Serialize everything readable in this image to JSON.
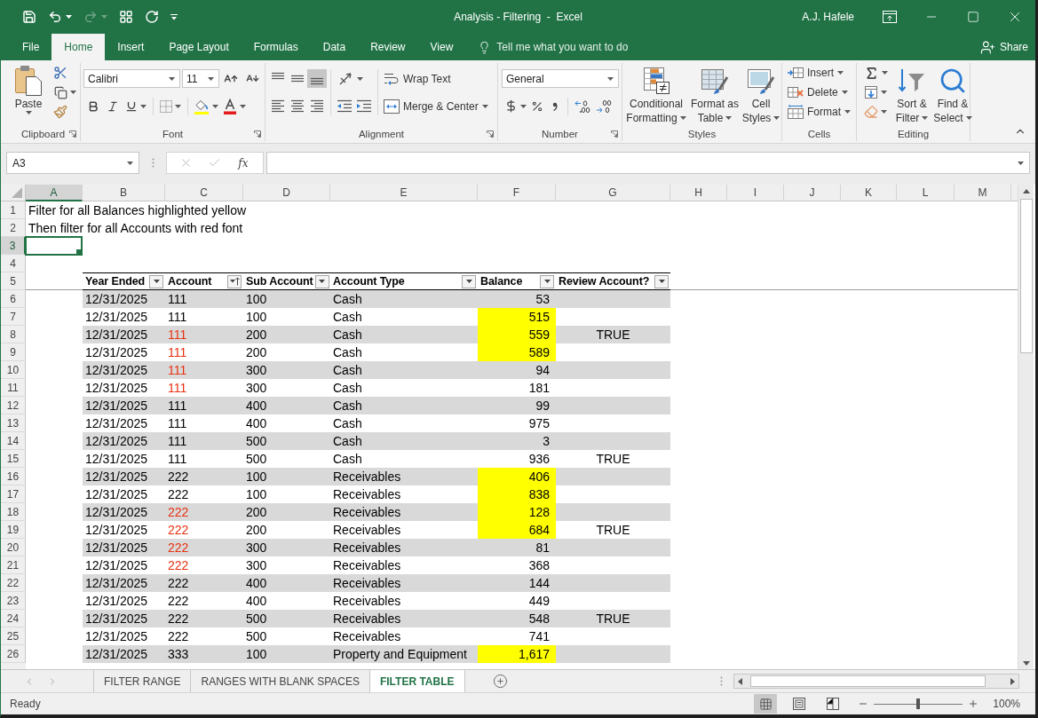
{
  "window": {
    "title": "Analysis - Filtering  -  Excel",
    "user": "A.J. Hafele"
  },
  "quick_access": [
    {
      "kind": "save",
      "disabled": false
    },
    {
      "kind": "undo",
      "disabled": false
    },
    {
      "kind": "redo",
      "disabled": true
    },
    {
      "kind": "form",
      "disabled": false
    },
    {
      "kind": "refresh",
      "disabled": false
    },
    {
      "kind": "customize",
      "disabled": false
    }
  ],
  "ribbon_tabs": [
    {
      "label": "File",
      "selected": false
    },
    {
      "label": "Home",
      "selected": true
    },
    {
      "label": "Insert",
      "selected": false
    },
    {
      "label": "Page Layout",
      "selected": false
    },
    {
      "label": "Formulas",
      "selected": false
    },
    {
      "label": "Data",
      "selected": false
    },
    {
      "label": "Review",
      "selected": false
    },
    {
      "label": "View",
      "selected": false
    }
  ],
  "tell_me": {
    "label": "Tell me what you want to do"
  },
  "share": {
    "label": "Share"
  },
  "clipboard": {
    "label": "Clipboard",
    "paste": "Paste"
  },
  "font": {
    "label": "Font",
    "name": "Calibri",
    "size": "11"
  },
  "alignment": {
    "label": "Alignment",
    "vertical": [
      {
        "kind": "top",
        "selected": false
      },
      {
        "kind": "middle",
        "selected": false
      },
      {
        "kind": "bottom",
        "selected": true
      }
    ],
    "wrap_text": "Wrap Text",
    "merge_center": "Merge & Center"
  },
  "number": {
    "label": "Number",
    "format": "General"
  },
  "styles": {
    "label": "Styles",
    "buttons": [
      {
        "kind": "conditional",
        "lines": [
          "Conditional",
          "Formatting"
        ]
      },
      {
        "kind": "table",
        "lines": [
          "Format as",
          "Table"
        ]
      },
      {
        "kind": "cell",
        "lines": [
          "Cell",
          "Styles"
        ]
      }
    ]
  },
  "cells": {
    "label": "Cells",
    "buttons": [
      {
        "kind": "insert",
        "label": "Insert"
      },
      {
        "kind": "delete",
        "label": "Delete"
      },
      {
        "kind": "format",
        "label": "Format"
      }
    ]
  },
  "editing": {
    "label": "Editing",
    "buttons": [
      {
        "kind": "sort",
        "lines": [
          "Sort &",
          "Filter"
        ]
      },
      {
        "kind": "find",
        "lines": [
          "Find &",
          "Select"
        ]
      }
    ]
  },
  "formula_bar": {
    "name_box": "A3",
    "insert_function": "fx"
  },
  "column_headers": [
    {
      "label": "A",
      "selected": true
    },
    {
      "label": "B",
      "selected": false
    },
    {
      "label": "C",
      "selected": false
    },
    {
      "label": "D",
      "selected": false
    },
    {
      "label": "E",
      "selected": false
    },
    {
      "label": "F",
      "selected": false
    },
    {
      "label": "G",
      "selected": false
    },
    {
      "label": "H",
      "selected": false
    },
    {
      "label": "I",
      "selected": false
    },
    {
      "label": "J",
      "selected": false
    },
    {
      "label": "K",
      "selected": false
    },
    {
      "label": "L",
      "selected": false
    },
    {
      "label": "M",
      "selected": false
    }
  ],
  "row_headers": [
    {
      "label": "1",
      "selected": false
    },
    {
      "label": "2",
      "selected": false
    },
    {
      "label": "3",
      "selected": true
    },
    {
      "label": "4",
      "selected": false
    },
    {
      "label": "5",
      "selected": false
    },
    {
      "label": "6",
      "selected": false
    },
    {
      "label": "7",
      "selected": false
    },
    {
      "label": "8",
      "selected": false
    },
    {
      "label": "9",
      "selected": false
    },
    {
      "label": "10",
      "selected": false
    },
    {
      "label": "11",
      "selected": false
    },
    {
      "label": "12",
      "selected": false
    },
    {
      "label": "13",
      "selected": false
    },
    {
      "label": "14",
      "selected": false
    },
    {
      "label": "15",
      "selected": false
    },
    {
      "label": "16",
      "selected": false
    },
    {
      "label": "17",
      "selected": false
    },
    {
      "label": "18",
      "selected": false
    },
    {
      "label": "19",
      "selected": false
    },
    {
      "label": "20",
      "selected": false
    },
    {
      "label": "21",
      "selected": false
    },
    {
      "label": "22",
      "selected": false
    },
    {
      "label": "23",
      "selected": false
    },
    {
      "label": "24",
      "selected": false
    },
    {
      "label": "25",
      "selected": false
    },
    {
      "label": "26",
      "selected": false
    }
  ],
  "sheet": {
    "notes": [
      "Filter for all Balances highlighted yellow",
      "Then filter for all Accounts with red font"
    ]
  },
  "table": {
    "columns": [
      {
        "label": "Year Ended",
        "sorted": false
      },
      {
        "label": "Account",
        "sorted": true
      },
      {
        "label": "Sub Account",
        "sorted": false
      },
      {
        "label": "Account Type",
        "sorted": false
      },
      {
        "label": "Balance",
        "sorted": false
      },
      {
        "label": "Review Account?",
        "sorted": false
      }
    ],
    "rows": [
      {
        "year_ended": "12/31/2025",
        "account": "111",
        "red_font": false,
        "sub_account": "100",
        "account_type": "Cash",
        "balance": "53",
        "highlighted": false
      },
      {
        "year_ended": "12/31/2025",
        "account": "111",
        "red_font": false,
        "sub_account": "100",
        "account_type": "Cash",
        "balance": "515",
        "highlighted": true
      },
      {
        "year_ended": "12/31/2025",
        "account": "111",
        "red_font": true,
        "sub_account": "200",
        "account_type": "Cash",
        "balance": "559",
        "highlighted": true,
        "review_account": "TRUE"
      },
      {
        "year_ended": "12/31/2025",
        "account": "111",
        "red_font": true,
        "sub_account": "200",
        "account_type": "Cash",
        "balance": "589",
        "highlighted": true
      },
      {
        "year_ended": "12/31/2025",
        "account": "111",
        "red_font": true,
        "sub_account": "300",
        "account_type": "Cash",
        "balance": "94",
        "highlighted": false
      },
      {
        "year_ended": "12/31/2025",
        "account": "111",
        "red_font": true,
        "sub_account": "300",
        "account_type": "Cash",
        "balance": "181",
        "highlighted": false
      },
      {
        "year_ended": "12/31/2025",
        "account": "111",
        "red_font": false,
        "sub_account": "400",
        "account_type": "Cash",
        "balance": "99",
        "highlighted": false
      },
      {
        "year_ended": "12/31/2025",
        "account": "111",
        "red_font": false,
        "sub_account": "400",
        "account_type": "Cash",
        "balance": "975",
        "highlighted": false
      },
      {
        "year_ended": "12/31/2025",
        "account": "111",
        "red_font": false,
        "sub_account": "500",
        "account_type": "Cash",
        "balance": "3",
        "highlighted": false
      },
      {
        "year_ended": "12/31/2025",
        "account": "111",
        "red_font": false,
        "sub_account": "500",
        "account_type": "Cash",
        "balance": "936",
        "highlighted": false,
        "review_account": "TRUE"
      },
      {
        "year_ended": "12/31/2025",
        "account": "222",
        "red_font": false,
        "sub_account": "100",
        "account_type": "Receivables",
        "balance": "406",
        "highlighted": true
      },
      {
        "year_ended": "12/31/2025",
        "account": "222",
        "red_font": false,
        "sub_account": "100",
        "account_type": "Receivables",
        "balance": "838",
        "highlighted": true
      },
      {
        "year_ended": "12/31/2025",
        "account": "222",
        "red_font": true,
        "sub_account": "200",
        "account_type": "Receivables",
        "balance": "128",
        "highlighted": true
      },
      {
        "year_ended": "12/31/2025",
        "account": "222",
        "red_font": true,
        "sub_account": "200",
        "account_type": "Receivables",
        "balance": "684",
        "highlighted": true,
        "review_account": "TRUE"
      },
      {
        "year_ended": "12/31/2025",
        "account": "222",
        "red_font": true,
        "sub_account": "300",
        "account_type": "Receivables",
        "balance": "81",
        "highlighted": false
      },
      {
        "year_ended": "12/31/2025",
        "account": "222",
        "red_font": true,
        "sub_account": "300",
        "account_type": "Receivables",
        "balance": "368",
        "highlighted": false
      },
      {
        "year_ended": "12/31/2025",
        "account": "222",
        "red_font": false,
        "sub_account": "400",
        "account_type": "Receivables",
        "balance": "144",
        "highlighted": false
      },
      {
        "year_ended": "12/31/2025",
        "account": "222",
        "red_font": false,
        "sub_account": "400",
        "account_type": "Receivables",
        "balance": "449",
        "highlighted": false
      },
      {
        "year_ended": "12/31/2025",
        "account": "222",
        "red_font": false,
        "sub_account": "500",
        "account_type": "Receivables",
        "balance": "548",
        "highlighted": false,
        "review_account": "TRUE"
      },
      {
        "year_ended": "12/31/2025",
        "account": "222",
        "red_font": false,
        "sub_account": "500",
        "account_type": "Receivables",
        "balance": "741",
        "highlighted": false
      },
      {
        "year_ended": "12/31/2025",
        "account": "333",
        "red_font": false,
        "sub_account": "100",
        "account_type": "Property and Equipment",
        "balance": "1,617",
        "highlighted": true
      }
    ]
  },
  "sheet_tabs": [
    {
      "label": "FILTER RANGE",
      "selected": false
    },
    {
      "label": "RANGES WITH BLANK SPACES",
      "selected": false
    },
    {
      "label": "FILTER TABLE",
      "selected": true
    }
  ],
  "status_bar": {
    "text": "Ready",
    "views": [
      {
        "kind": "normal",
        "selected": true
      },
      {
        "kind": "page_layout",
        "selected": false
      },
      {
        "kind": "page_break",
        "selected": false
      }
    ],
    "zoom": {
      "level": 0.5,
      "label": "100%"
    }
  }
}
